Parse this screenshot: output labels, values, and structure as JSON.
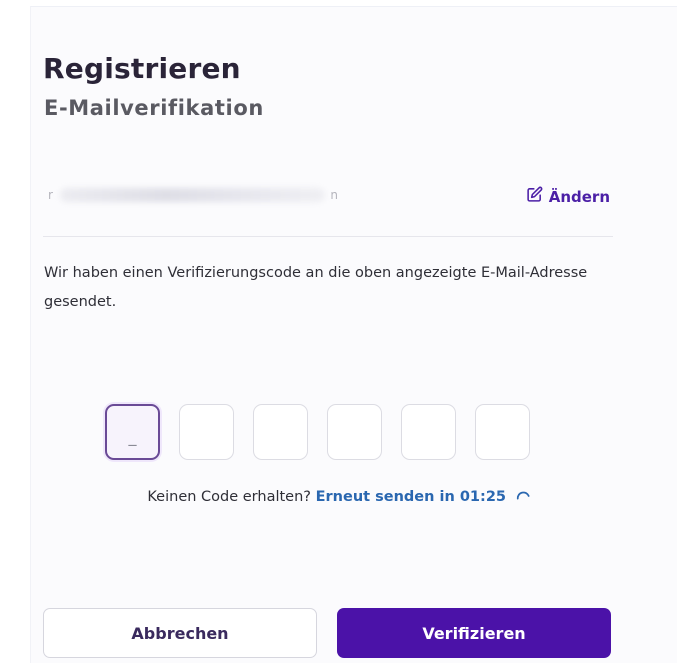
{
  "header": {
    "title": "Registrieren",
    "subtitle": "E-Mailverifikation"
  },
  "email": {
    "first_char": "r",
    "last_char": "n",
    "change_label": "Ändern",
    "change_icon": "edit-icon"
  },
  "info_text": "Wir haben einen Verifizierungscode an die oben angezeigte E-Mail-Adresse gesendet.",
  "otp": {
    "length": 6,
    "values": [
      "_",
      "",
      "",
      "",
      "",
      ""
    ]
  },
  "resend": {
    "prompt": "Keinen Code erhalten?",
    "link_text": "Erneut senden in 01:25",
    "icon": "loading-spinner-icon"
  },
  "buttons": {
    "cancel": "Abbrechen",
    "verify": "Verifizieren"
  },
  "colors": {
    "primary": "#4b12a8",
    "link_blue": "#2a67b0",
    "title": "#2a2438"
  }
}
